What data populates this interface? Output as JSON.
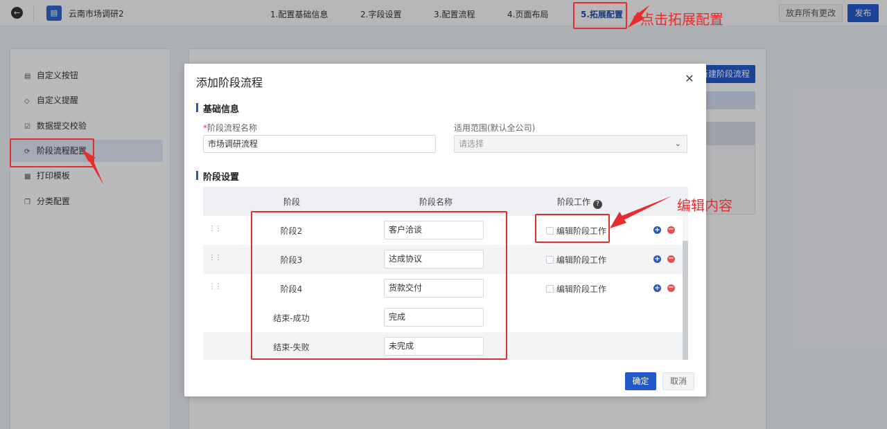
{
  "topbar": {
    "app_title": "云南市场调研2",
    "steps": [
      {
        "label": "1.配置基础信息"
      },
      {
        "label": "2.字段设置"
      },
      {
        "label": "3.配置流程"
      },
      {
        "label": "4.页面布局"
      },
      {
        "label": "5.拓展配置"
      }
    ],
    "discard_label": "放弃所有更改",
    "publish_label": "发布"
  },
  "sidebar": {
    "items": [
      {
        "label": "自定义按钮",
        "icon": "button-icon"
      },
      {
        "label": "自定义提醒",
        "icon": "reminder-icon"
      },
      {
        "label": "数据提交校验",
        "icon": "check-icon"
      },
      {
        "label": "阶段流程配置",
        "icon": "flow-icon"
      },
      {
        "label": "打印模板",
        "icon": "printer-icon"
      },
      {
        "label": "分类配置",
        "icon": "category-icon"
      }
    ]
  },
  "main": {
    "new_stage_flow_label": "新建阶段流程"
  },
  "modal": {
    "title": "添加阶段流程",
    "basic_section": "基础信息",
    "name_label": "阶段流程名称",
    "name_required_mark": "*",
    "name_value": "市场调研流程",
    "scope_label": "适用范围(默认全公司)",
    "scope_placeholder": "请选择",
    "stage_section": "阶段设置",
    "table_headers": {
      "stage": "阶段",
      "stage_name": "阶段名称",
      "stage_work": "阶段工作"
    },
    "rows": [
      {
        "stage": "阶段2",
        "name": "客户洽谈",
        "work": "编辑阶段工作"
      },
      {
        "stage": "阶段3",
        "name": "达成协议",
        "work": "编辑阶段工作"
      },
      {
        "stage": "阶段4",
        "name": "货款交付",
        "work": "编辑阶段工作"
      },
      {
        "stage": "结束-成功",
        "name": "完成",
        "work": ""
      },
      {
        "stage": "结束-失败",
        "name": "未完成",
        "work": ""
      }
    ],
    "ok_label": "确定",
    "cancel_label": "取消"
  },
  "annotations": {
    "click_extension": "点击拓展配置",
    "edit_content": "编辑内容",
    "color": "#e52d2d"
  },
  "colors": {
    "primary": "#2358c8",
    "danger": "#e95050"
  }
}
